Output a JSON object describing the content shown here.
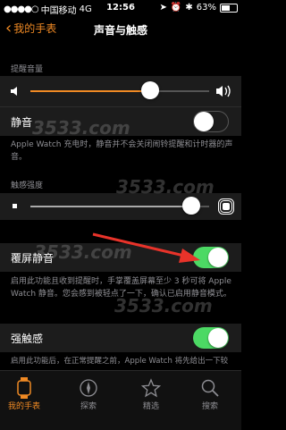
{
  "status_bar": {
    "carrier": "中国移动",
    "network": "4G",
    "time": "12:56",
    "battery_percent": "63%",
    "battery_level": 0.63
  },
  "nav": {
    "back_label": "我的手表",
    "title": "声音与触感"
  },
  "alert_volume": {
    "section_label": "提醒音量",
    "level": 0.67
  },
  "mute": {
    "label": "静音",
    "on": false,
    "footnote": "Apple Watch 充电时，静音并不会关闭闹铃提醒和计时器的声音。"
  },
  "haptic_strength": {
    "section_label": "触感强度",
    "level": 0.9
  },
  "cover_to_mute": {
    "label": "覆屏静音",
    "on": true,
    "footnote": "启用此功能且收到提醒时，手掌覆盖屏幕至少 3 秒可将 Apple Watch 静音。您会感到被轻点了一下，确认已启用静音模式。"
  },
  "prominent_haptic": {
    "label": "强触感",
    "on": true,
    "footnote": "启用此功能后，在正常提醒之前，Apple Watch 将先给出一下较强的触感提醒。"
  },
  "watermark_text": "3533.com",
  "tabs": [
    {
      "label": "我的手表",
      "icon": "watch-icon",
      "active": true
    },
    {
      "label": "探索",
      "icon": "compass-icon",
      "active": false
    },
    {
      "label": "精选",
      "icon": "star-icon",
      "active": false
    },
    {
      "label": "搜索",
      "icon": "search-icon",
      "active": false
    }
  ],
  "colors": {
    "accent": "#f08a24",
    "toggle_on": "#4cd964",
    "secondary_text": "#8e8e93",
    "arrow": "#e8332a"
  }
}
